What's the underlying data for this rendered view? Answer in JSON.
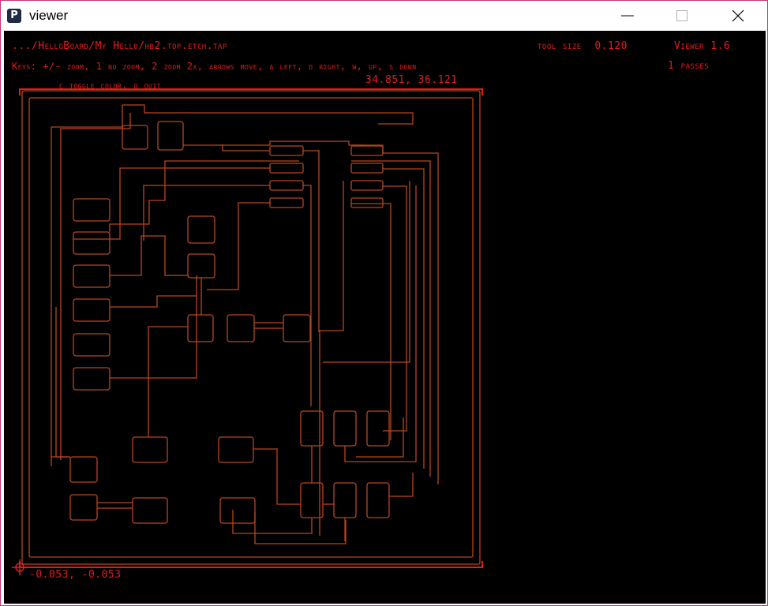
{
  "window": {
    "title": "viewer",
    "icon_name": "processing-app-icon",
    "icon_glyph": "P",
    "controls": [
      "minimize-icon",
      "maximize-icon",
      "close-icon"
    ]
  },
  "viewer": {
    "file_path": ".../HelloBoard/My Hello/hb2.top.etch.tap",
    "tool_size": "tool size  0.120",
    "version": "Viewer 1.6",
    "keys_line": "Keys: +/- zoom, 1 no zoom, 2 zoom 2x, arrows move, a left, d right, w, up, s down",
    "keys_line2": "c toggle color, q quit",
    "passes": "1 passes",
    "cursor_coords": "34.851, 36.121",
    "origin_coords": "-0.053, -0.053",
    "origin_marker": "crosshair-icon"
  },
  "colors": {
    "background": "#000000",
    "hud_text": "#e31b1b",
    "toolpath": "#b8451f",
    "frame": "#e31b1b"
  }
}
